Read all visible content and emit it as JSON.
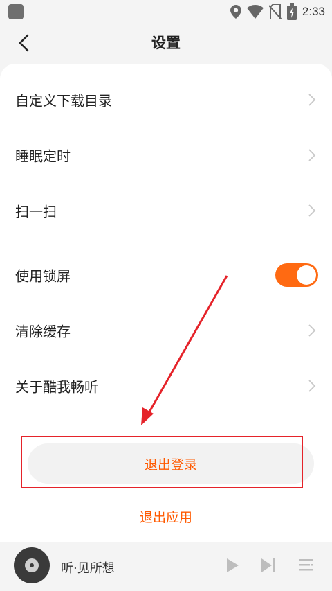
{
  "status_bar": {
    "time": "2:33"
  },
  "header": {
    "title": "设置"
  },
  "settings": {
    "items": [
      {
        "label": "自定义下载目录"
      },
      {
        "label": "睡眠定时"
      },
      {
        "label": "扫一扫"
      },
      {
        "label": "使用锁屏"
      },
      {
        "label": "清除缓存"
      },
      {
        "label": "关于酷我畅听"
      }
    ],
    "lock_screen_enabled": true
  },
  "actions": {
    "logout_label": "退出登录",
    "exit_app_label": "退出应用"
  },
  "player": {
    "track_title": "听·见所想"
  },
  "colors": {
    "accent": "#ff5a00",
    "toggle": "#ff6a12",
    "annotation": "#e5232a"
  }
}
